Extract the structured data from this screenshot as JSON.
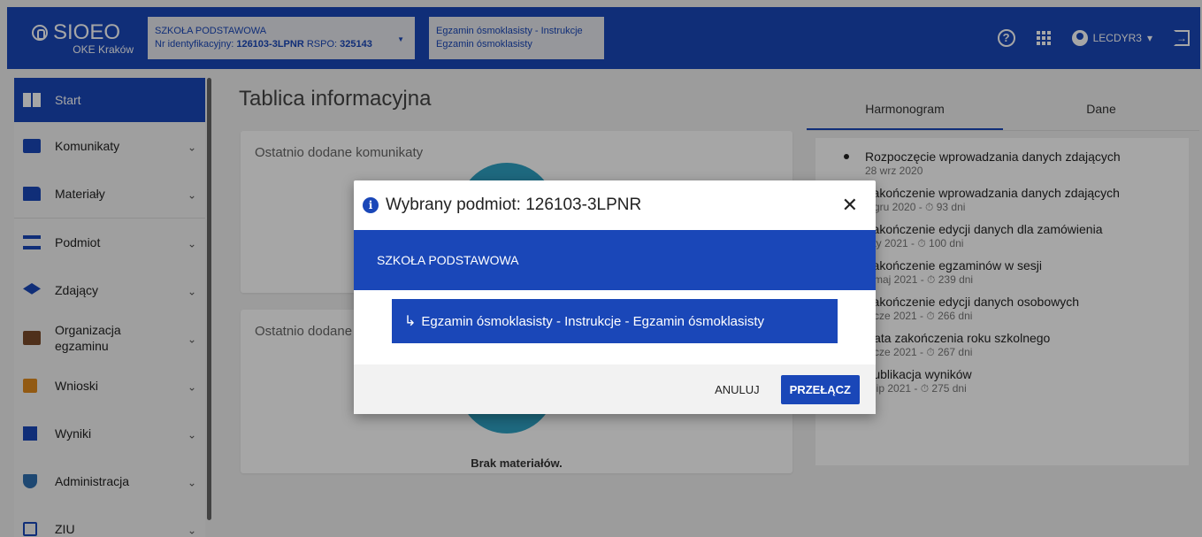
{
  "header": {
    "logo_title": "SIOEO",
    "logo_subtitle": "OKE Kraków",
    "context1": {
      "line1": "SZKOŁA PODSTAWOWA",
      "id_label": "Nr identyfikacyjny:",
      "id_value": "126103-3LPNR",
      "rspo_label": "RSPO:",
      "rspo_value": "325143"
    },
    "context2": {
      "line1": "Egzamin ósmoklasisty - Instrukcje",
      "line2": "Egzamin ósmoklasisty"
    },
    "user_name": "LECDYR3"
  },
  "sidebar": {
    "items": [
      {
        "label": "Start",
        "icon": "dashboard-icon"
      },
      {
        "label": "Komunikaty",
        "icon": "message-icon"
      },
      {
        "label": "Materiały",
        "icon": "folder-icon"
      },
      {
        "label": "Podmiot",
        "icon": "institution-icon"
      },
      {
        "label": "Zdający",
        "icon": "graduation-cap-icon"
      },
      {
        "label": "Organizacja egzaminu",
        "icon": "organization-icon"
      },
      {
        "label": "Wnioski",
        "icon": "clipboard-icon"
      },
      {
        "label": "Wyniki",
        "icon": "bar-chart-icon"
      },
      {
        "label": "Administracja",
        "icon": "shield-icon"
      },
      {
        "label": "ZIU",
        "icon": "ziu-icon"
      }
    ]
  },
  "main": {
    "title": "Tablica informacyjna",
    "card1_title": "Ostatnio dodane komunikaty",
    "card2_title": "Ostatnio dodane materiały",
    "card2_empty": "Brak materiałów."
  },
  "right": {
    "tabs": [
      "Harmonogram",
      "Dane"
    ],
    "schedule": [
      {
        "title": "Rozpoczęcie wprowadzania danych zdających",
        "date": "28 wrz 2020"
      },
      {
        "title": "Zakończenie wprowadzania danych zdających",
        "date": "1 gru 2020 - ⏱ 93 dni"
      },
      {
        "title": "Zakończenie edycji danych dla zamówienia",
        "date": "luty 2021 - ⏱ 100 dni"
      },
      {
        "title": "Zakończenie egzaminów w sesji",
        "date": "7 maj 2021 - ⏱ 239 dni"
      },
      {
        "title": "Zakończenie edycji danych osobowych",
        "date": "3 cze 2021 - ⏱ 266 dni"
      },
      {
        "title": "Data zakończenia roku szkolnego",
        "date": "4 cze 2021 - ⏱ 267 dni"
      },
      {
        "title": "Publikacja wyników",
        "date": "2 lip 2021 - ⏱ 275 dni"
      }
    ]
  },
  "dialog": {
    "title": "Wybrany podmiot: 126103-3LPNR",
    "school": "SZKOŁA PODSTAWOWA",
    "option": "Egzamin ósmoklasisty - Instrukcje - Egzamin ósmoklasisty",
    "cancel_label": "ANULUJ",
    "switch_label": "PRZEŁĄCZ"
  },
  "colors": {
    "brand": "#1a47b8",
    "teal": "#2fa2c3",
    "status_green": "#1f8f3a"
  }
}
